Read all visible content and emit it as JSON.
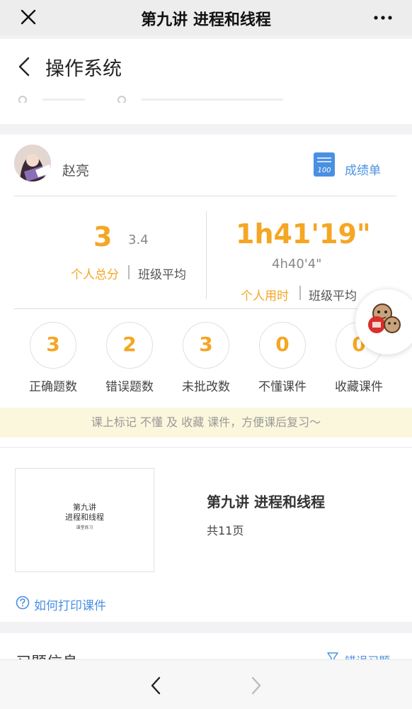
{
  "topbar": {
    "title": "第九讲 进程和线程"
  },
  "header": {
    "course_title": "操作系统"
  },
  "user": {
    "name": "赵亮"
  },
  "report": {
    "label": "成绩单"
  },
  "score": {
    "personal": "3",
    "class_avg": "3.4",
    "personal_label": "个人总分",
    "avg_label": "班级平均"
  },
  "time": {
    "personal": "1h41'19\"",
    "class_avg": "4h40'4\"",
    "personal_label": "个人用时",
    "avg_label": "班级平均"
  },
  "counts": [
    {
      "value": "3",
      "label": "正确题数"
    },
    {
      "value": "2",
      "label": "错误题数"
    },
    {
      "value": "3",
      "label": "未批改数"
    },
    {
      "value": "0",
      "label": "不懂课件"
    },
    {
      "value": "0",
      "label": "收藏课件"
    }
  ],
  "tip": "课上标记 不懂 及 收藏 课件，方便课后复习～",
  "courseware": {
    "thumb_line1": "第九讲",
    "thumb_line2": "进程和线程",
    "thumb_sub": "课堂练习",
    "title": "第九讲 进程和线程",
    "pages": "共11页",
    "help": "如何打印课件"
  },
  "exercise": {
    "title": "习题信息",
    "filter_label": "错误习题"
  },
  "colors": {
    "accent": "#f5a623",
    "link": "#4a90e2"
  }
}
